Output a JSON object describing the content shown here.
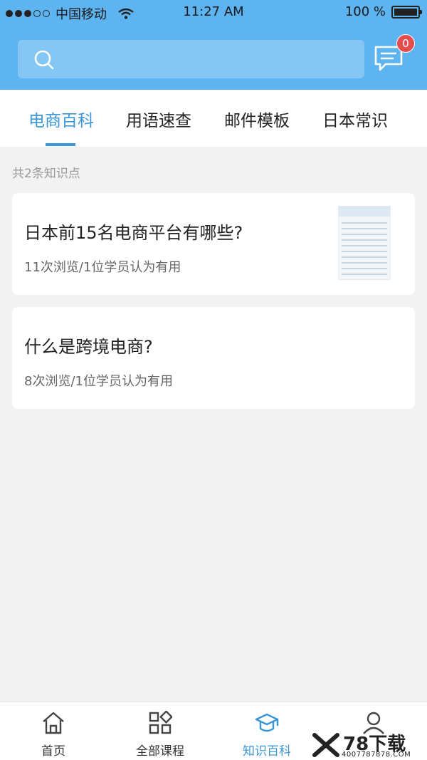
{
  "status_bar": {
    "carrier": "中国移动",
    "time": "11:27 AM",
    "battery": "100 %",
    "signal_level": 0.6,
    "battery_level": 1.0
  },
  "search": {
    "placeholder": ""
  },
  "messages": {
    "badge_count": "0"
  },
  "tabs": [
    {
      "label": "电商百科",
      "active": true
    },
    {
      "label": "用语速查",
      "active": false
    },
    {
      "label": "邮件模板",
      "active": false
    },
    {
      "label": "日本常识",
      "active": false
    }
  ],
  "list": {
    "count_label": "共2条知识点",
    "items": [
      {
        "title": "日本前15名电商平台有哪些?",
        "meta": "11次浏览/1位学员认为有用",
        "has_thumbnail": true
      },
      {
        "title": "什么是跨境电商?",
        "meta": "8次浏览/1位学员认为有用",
        "has_thumbnail": false
      }
    ]
  },
  "bottom_nav": [
    {
      "label": "首页",
      "icon": "home-icon",
      "active": false
    },
    {
      "label": "全部课程",
      "icon": "grid-icon",
      "active": false
    },
    {
      "label": "知识百科",
      "icon": "graduation-cap-icon",
      "active": true
    },
    {
      "label": "",
      "icon": "user-icon",
      "active": false
    }
  ],
  "watermark": {
    "text": "78下载",
    "sub": "4007787878.COM"
  },
  "colors": {
    "header": "#5eb4f1",
    "accent": "#3a96d6",
    "badge": "#e44d4d"
  }
}
